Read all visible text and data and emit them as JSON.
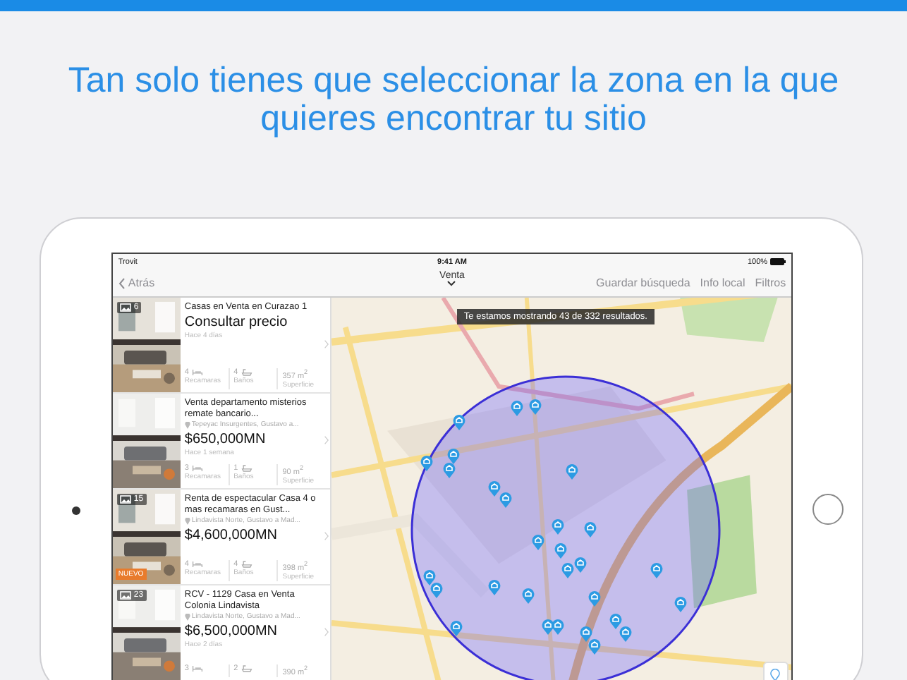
{
  "headline": "Tan solo tienes que seleccionar la zona en la que quieres encontrar tu sitio",
  "status_bar": {
    "carrier": "Trovit",
    "time": "9:41 AM",
    "battery": "100%"
  },
  "nav_bar": {
    "back": "Atrás",
    "title": "Venta",
    "actions": [
      "Guardar búsqueda",
      "Info local",
      "Filtros"
    ]
  },
  "listings": [
    {
      "photo_count": "6",
      "title": "Casas en Venta en Curazao 1",
      "price": "Consultar precio",
      "posted": "Hace 4 días",
      "stats": [
        {
          "kind": "bedrooms",
          "value": "4",
          "label": "Recamaras"
        },
        {
          "kind": "bathrooms",
          "value": "4",
          "label": "Baños"
        },
        {
          "kind": "area",
          "value": "357 m$^{2}$",
          "label": "Superficie"
        }
      ]
    },
    {
      "title": "Venta departamento misterios remate bancario...",
      "location": "Tepeyac Insurgentes, Gustavo a...",
      "price": "$650,000MN",
      "posted": "Hace 1 semana",
      "stats": [
        {
          "kind": "bedrooms",
          "value": "3",
          "label": "Recamaras"
        },
        {
          "kind": "bathrooms",
          "value": "1",
          "label": "Baños"
        },
        {
          "kind": "area",
          "value": "90 m$^{2}$",
          "label": "Superficie"
        }
      ]
    },
    {
      "photo_count": "15",
      "badge": "NUEVO",
      "title": "Renta de espectacular Casa 4 o mas recamaras en Gust...",
      "location": "Lindavista Norte, Gustavo a Mad...",
      "price": "$4,600,000MN",
      "stats": [
        {
          "kind": "bedrooms",
          "value": "4",
          "label": "Recamaras"
        },
        {
          "kind": "bathrooms",
          "value": "4",
          "label": "Baños"
        },
        {
          "kind": "area",
          "value": "398 m$^{2}$",
          "label": "Superficie"
        }
      ]
    },
    {
      "photo_count": "23",
      "title": "RCV - 1129 Casa en Venta Colonia Lindavista",
      "location": "Lindavista Norte, Gustavo a Mad...",
      "price": "$6,500,000MN",
      "posted": "Hace 2 días",
      "stats": [
        {
          "kind": "bedrooms",
          "value": "3"
        },
        {
          "kind": "bathrooms",
          "value": "2"
        },
        {
          "kind": "area",
          "value": "390 m$^{2}$"
        }
      ]
    }
  ],
  "map": {
    "notice": "Te estamos mostrando 43 de 332 resultados."
  }
}
